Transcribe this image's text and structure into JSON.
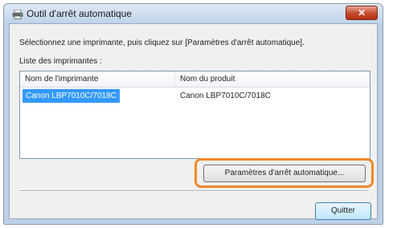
{
  "window": {
    "title": "Outil d'arrêt automatique",
    "close_glyph": "✕",
    "icon": "printer-icon"
  },
  "content": {
    "instruction": "Sélectionnez une imprimante, puis cliquez sur [Paramètres d'arrêt automatique].",
    "list_label": "Liste des imprimantes :"
  },
  "printer_list": {
    "columns": [
      "Nom de l'imprimante",
      "Nom du produit"
    ],
    "rows": [
      {
        "printer_name": "Canon LBP7010C/7018C",
        "product_name": "Canon LBP7010C/7018C",
        "selected": true
      }
    ]
  },
  "buttons": {
    "settings_label": "Paramètres d'arrêt automatique...",
    "quit_label": "Quitter"
  },
  "colors": {
    "highlight": "#f0892a",
    "selection": "#3399ff",
    "close_button": "#c7482c"
  }
}
